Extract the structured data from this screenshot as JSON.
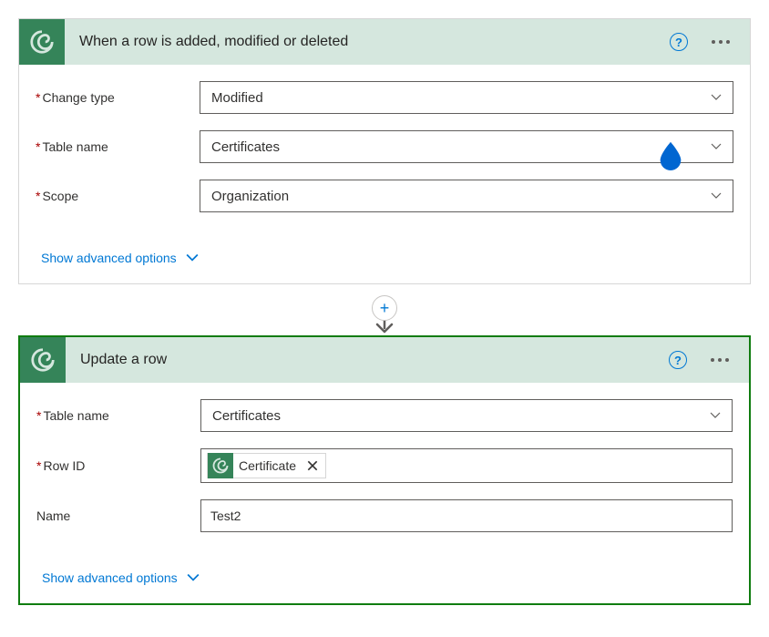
{
  "trigger": {
    "title": "When a row is added, modified or deleted",
    "fields": {
      "changeType": {
        "label": "Change type",
        "value": "Modified"
      },
      "tableName": {
        "label": "Table name",
        "value": "Certificates"
      },
      "scope": {
        "label": "Scope",
        "value": "Organization"
      }
    },
    "advancedLink": "Show advanced options"
  },
  "action": {
    "title": "Update a row",
    "fields": {
      "tableName": {
        "label": "Table name",
        "value": "Certificates"
      },
      "rowId": {
        "label": "Row ID",
        "tokenLabel": "Certificate"
      },
      "name": {
        "label": "Name",
        "value": "Test2"
      }
    },
    "advancedLink": "Show advanced options"
  }
}
